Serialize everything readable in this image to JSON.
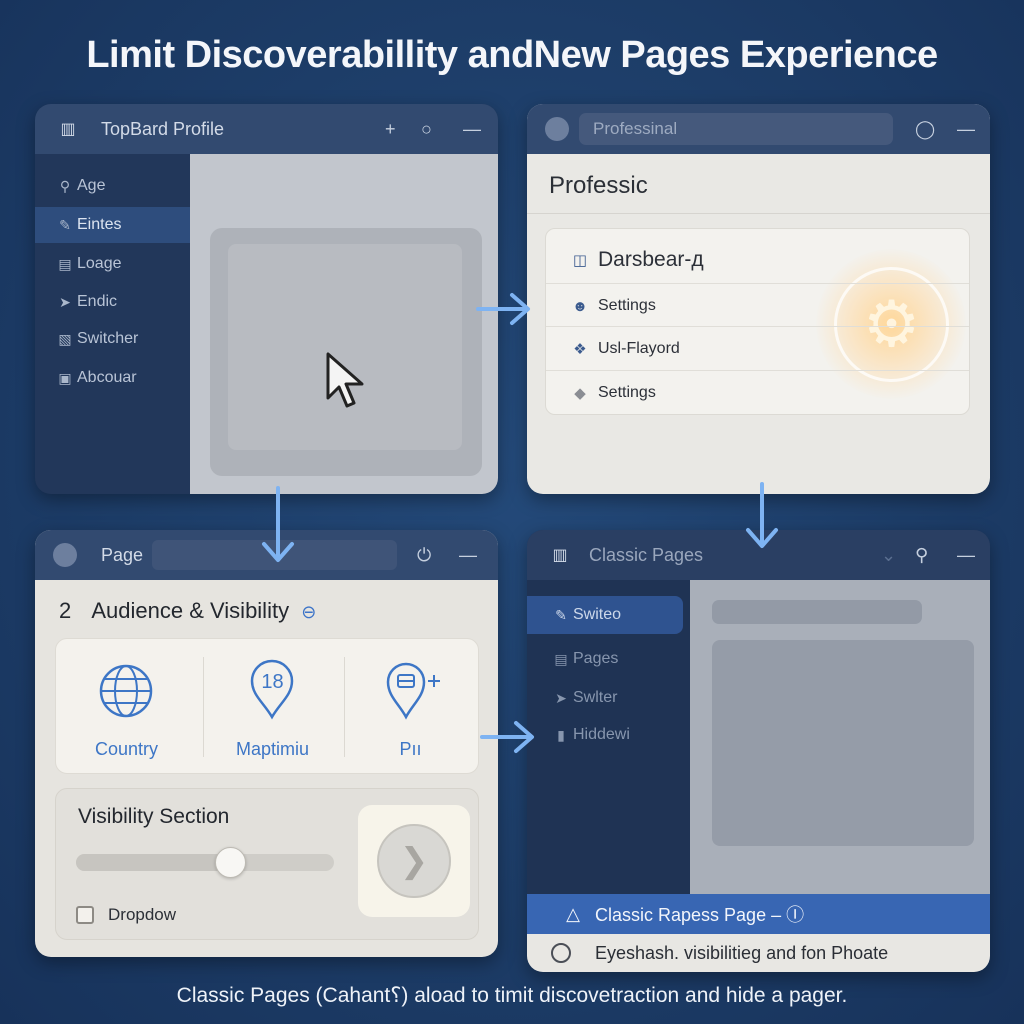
{
  "title": "Limit Discoverabillity andNew Pages Experience",
  "caption": "Classic Pages (Cahant⸮) aload to timit discovetraction and hide a pager.",
  "colors": {
    "accent": "#3d76c6",
    "arrow": "#7eb3f2",
    "background": "#1d3d68"
  },
  "panel1": {
    "titlebar": {
      "title": "TopBard Profile",
      "icons": [
        "profile-icon",
        "plus-icon",
        "bell-icon",
        "minimize-icon"
      ]
    },
    "sidebar": [
      {
        "label": "Age",
        "icon": "search-icon"
      },
      {
        "label": "Eintes",
        "icon": "edit-icon",
        "active": true
      },
      {
        "label": "Loage",
        "icon": "page-icon"
      },
      {
        "label": "Endic",
        "icon": "plane-icon"
      },
      {
        "label": "Switcher",
        "icon": "switch-icon"
      },
      {
        "label": "Abcouar",
        "icon": "info-icon"
      }
    ],
    "cursor": "cursor-icon"
  },
  "panel2": {
    "titlebar": {
      "search_placeholder": "Professinal",
      "icons": [
        "circle-icon",
        "chat-icon",
        "minimize-icon"
      ]
    },
    "heading": "Professic",
    "card_title": "Darsbear-д",
    "items": [
      {
        "label": "Settings",
        "icon": "users-icon"
      },
      {
        "label": "Usl-Flayord",
        "icon": "apps-icon"
      },
      {
        "label": "Settings",
        "icon": "shield-icon"
      }
    ],
    "highlight": "gear-icon"
  },
  "panel3": {
    "titlebar": {
      "title": "Page",
      "icons": [
        "profile-icon",
        "power-icon",
        "minimize-icon"
      ]
    },
    "step_number": "2",
    "heading": "Audience & Visibility",
    "options": [
      {
        "label": "Country",
        "icon": "globe-icon"
      },
      {
        "label": "Maptimiu",
        "icon": "pin-icon",
        "badge": "18"
      },
      {
        "label": "Pıı",
        "icon": "pin-add-icon"
      }
    ],
    "visibility": {
      "title": "Visibility Section",
      "slider_value": 0.6,
      "checkbox_label": "Dropdow",
      "checked": false
    }
  },
  "panel4": {
    "titlebar": {
      "title": "Classic Pages",
      "icons": [
        "profile-icon",
        "chevron-down-icon",
        "search-icon",
        "minimize-icon"
      ]
    },
    "sidebar": [
      {
        "label": "Switeo",
        "icon": "edit-icon",
        "active": true
      },
      {
        "label": "Pages",
        "icon": "page-icon"
      },
      {
        "label": "Swlter",
        "icon": "plane-icon"
      },
      {
        "label": "Hiddewi",
        "icon": "bookmark-icon"
      }
    ],
    "row_selected": "Classic Rapess Page – Ⓘ",
    "row_other": "Eyeshash. visibilitieg and fon Phoate"
  }
}
